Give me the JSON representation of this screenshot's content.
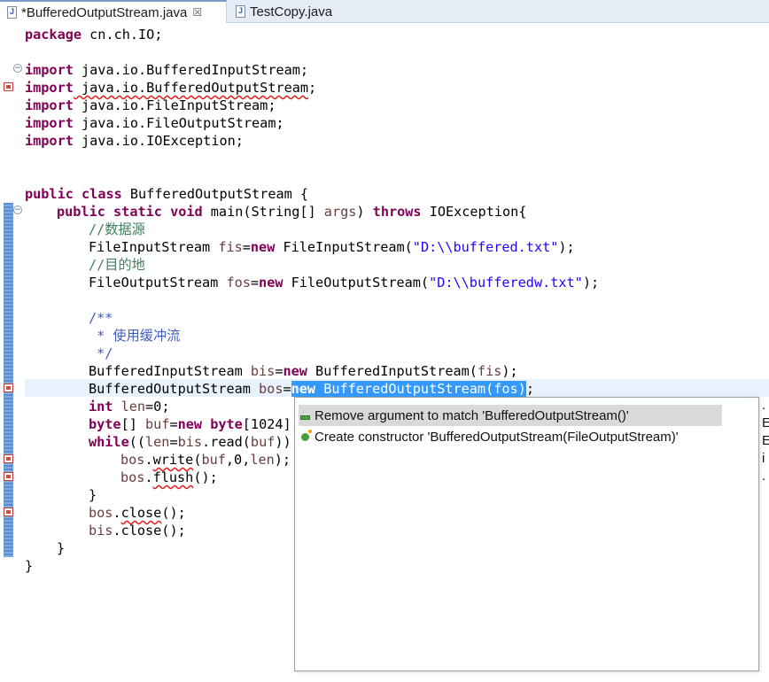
{
  "tabs": [
    {
      "label": "*BufferedOutputStream.java",
      "icon": "java-file-icon",
      "close": "☒",
      "active": true
    },
    {
      "label": "TestCopy.java",
      "icon": "java-file-icon",
      "active": false
    }
  ],
  "code": {
    "l1": {
      "k1": "package",
      "t1": " cn.ch.IO;"
    },
    "l3": {
      "k1": "import",
      "t1": " java.io.BufferedInputStream;"
    },
    "l4": {
      "k1": "import",
      "t1": " java.io.BufferedOutputStream",
      "t2": ";"
    },
    "l5": {
      "k1": "import",
      "t1": " java.io.FileInputStream;"
    },
    "l6": {
      "k1": "import",
      "t1": " java.io.FileOutputStream;"
    },
    "l7": {
      "k1": "import",
      "t1": " java.io.IOException;"
    },
    "l10": {
      "k1": "public",
      "k2": "class",
      "t1": " BufferedOutputStream {"
    },
    "l11": {
      "k1": "public",
      "k2": "static",
      "k3": "void",
      "t1": " main(String[] ",
      "v1": "args",
      "t2": ") ",
      "k4": "throws",
      "t3": " IOException{"
    },
    "l12": {
      "c1": "//数据源"
    },
    "l13": {
      "t1": "FileInputStream ",
      "v1": "fis",
      "t2": "=",
      "k1": "new",
      "t3": " FileInputStream(",
      "s1": "\"D:\\\\buffered.txt\"",
      "t4": ");"
    },
    "l14": {
      "c1": "//目的地"
    },
    "l15": {
      "t1": "FileOutputStream ",
      "v1": "fos",
      "t2": "=",
      "k1": "new",
      "t3": " FileOutputStream(",
      "s1": "\"D:\\\\bufferedw.txt\"",
      "t4": ");"
    },
    "l17": {
      "d1": "/**"
    },
    "l18": {
      "d1": " * 使用缓冲流"
    },
    "l19": {
      "d1": " */"
    },
    "l20": {
      "t1": "BufferedInputStream ",
      "v1": "bis",
      "t2": "=",
      "k1": "new",
      "t3": " BufferedInputStream(",
      "v2": "fis",
      "t4": ");"
    },
    "l21": {
      "t1": "BufferedOutputStream ",
      "v1": "bos",
      "t2": "=",
      "k1": "new",
      "t3": " BufferedOutputStream(",
      "v2": "fos",
      "t4": ")",
      "t5": ";"
    },
    "l22": {
      "k1": "int",
      "t1": " ",
      "v1": "len",
      "t2": "=0;"
    },
    "l23": {
      "k1": "byte",
      "t1": "[] ",
      "v1": "buf",
      "t2": "=",
      "k2": "new",
      "t3": " ",
      "k3": "byte",
      "t4": "[1024];"
    },
    "l24": {
      "k1": "while",
      "t1": "((",
      "v1": "len",
      "t2": "=",
      "v2": "bis",
      "t3": ".read(",
      "v3": "buf",
      "t4": "))!"
    },
    "l25": {
      "v1": "bos",
      "t1": ".",
      "e1": "write",
      "t2": "(",
      "v2": "buf",
      "t3": ",0,",
      "v3": "len",
      "t4": ");"
    },
    "l26": {
      "v1": "bos",
      "t1": ".",
      "e1": "flush",
      "t2": "();"
    },
    "l27": {
      "t1": "}"
    },
    "l28": {
      "v1": "bos",
      "t1": ".",
      "e1": "close",
      "t2": "();"
    },
    "l29": {
      "v1": "bis",
      "t1": ".close();"
    },
    "l30": {
      "t1": "}"
    },
    "l31": {
      "t1": "}"
    }
  },
  "quickfix": {
    "proposals": [
      {
        "label": "Remove argument to match 'BufferedOutputStream()'",
        "icon": "remove-argument-icon"
      },
      {
        "label": "Create constructor 'BufferedOutputStream(FileOutputStream)'",
        "icon": "create-constructor-icon"
      }
    ]
  },
  "info_strip": [
    ".",
    "E",
    "E",
    "i",
    "."
  ],
  "colors": {
    "keyword": "#7f0055",
    "string": "#2a00ff",
    "comment": "#3f7f5f",
    "javadoc": "#3f5fbf",
    "variable": "#6a3e3e",
    "selection": "#3399ff",
    "current_line": "#e8f2fe"
  }
}
